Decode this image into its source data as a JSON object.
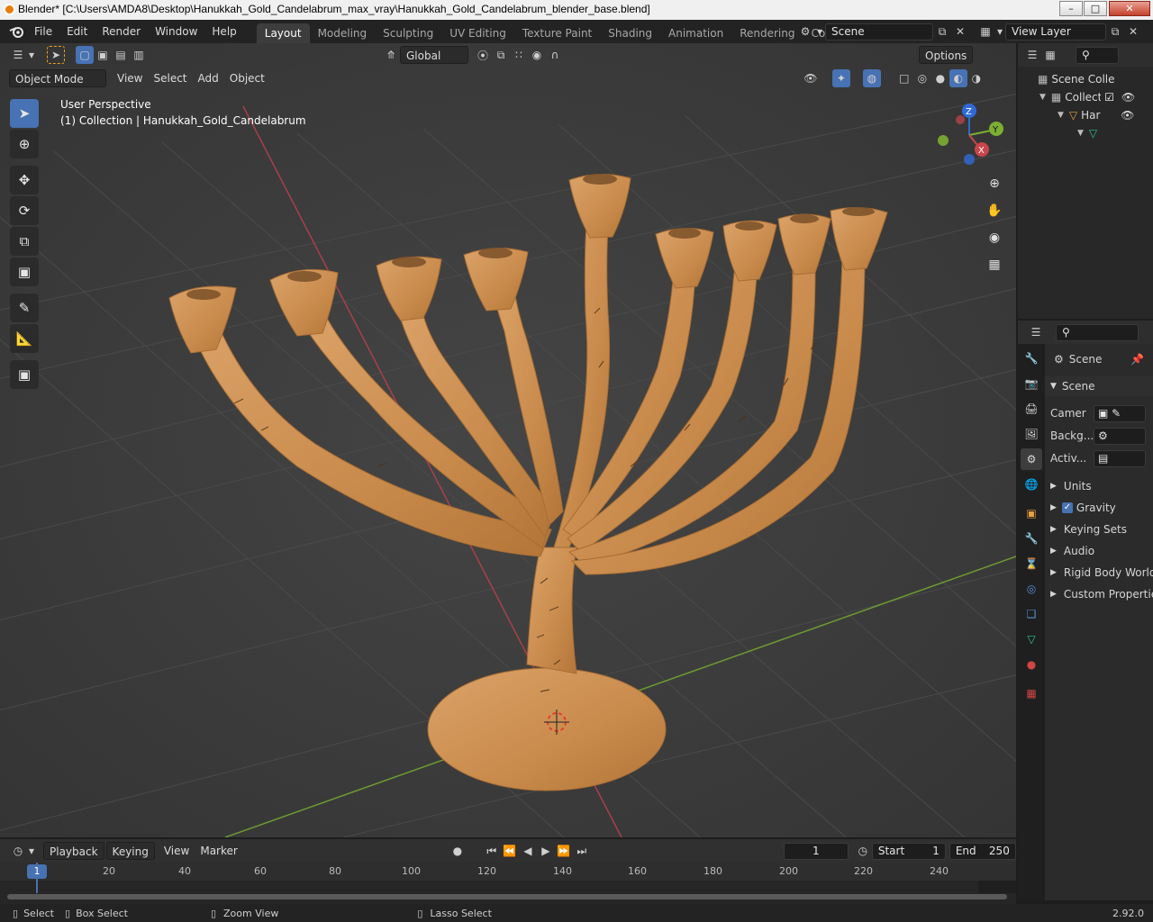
{
  "window": {
    "title": "Blender* [C:\\Users\\AMDA8\\Desktop\\Hanukkah_Gold_Candelabrum_max_vray\\Hanukkah_Gold_Candelabrum_blender_base.blend]",
    "min": "–",
    "max": "□",
    "close": "✕"
  },
  "menu": [
    "File",
    "Edit",
    "Render",
    "Window",
    "Help"
  ],
  "workspaces": [
    "Layout",
    "Modeling",
    "Sculpting",
    "UV Editing",
    "Texture Paint",
    "Shading",
    "Animation",
    "Rendering",
    "Compositing"
  ],
  "scene_field": "Scene",
  "view_layer_field": "View Layer",
  "viewport": {
    "mode": "Object Mode",
    "menus": [
      "View",
      "Select",
      "Add",
      "Object"
    ],
    "transform_orientation": "Global",
    "options": "Options",
    "overlay_title": "User Perspective",
    "overlay_subtitle": "(1) Collection | Hanukkah_Gold_Candelabrum",
    "gizmo": {
      "z": "Z",
      "y": "Y",
      "x": "X"
    }
  },
  "outliner": {
    "rows": [
      {
        "label": "Scene Colle"
      },
      {
        "label": "Collecti"
      },
      {
        "label": "Har"
      }
    ]
  },
  "properties": {
    "breadcrumb": "Scene",
    "panel": "Scene",
    "fields": [
      {
        "label": "Camer"
      },
      {
        "label": "Backg..."
      },
      {
        "label": "Activ..."
      }
    ],
    "sections": [
      "Units",
      "Gravity",
      "Keying Sets",
      "Audio",
      "Rigid Body World",
      "Custom Propertie"
    ]
  },
  "timeline": {
    "menus": [
      "Playback",
      "Keying",
      "View",
      "Marker"
    ],
    "current_frame": "1",
    "start_label": "Start",
    "start": "1",
    "end_label": "End",
    "end": "250",
    "ticks": [
      "1",
      "20",
      "40",
      "60",
      "80",
      "100",
      "120",
      "140",
      "160",
      "180",
      "200",
      "220",
      "240"
    ]
  },
  "status": {
    "select": "Select",
    "box_select": "Box Select",
    "zoom_view": "Zoom View",
    "lasso_select": "Lasso Select",
    "version": "2.92.0"
  },
  "colors": {
    "accent": "#4772b3",
    "x_axis": "#c8464b",
    "y_axis": "#7cae33",
    "z_axis": "#2f6ad6",
    "wood": "#c98b4c"
  }
}
